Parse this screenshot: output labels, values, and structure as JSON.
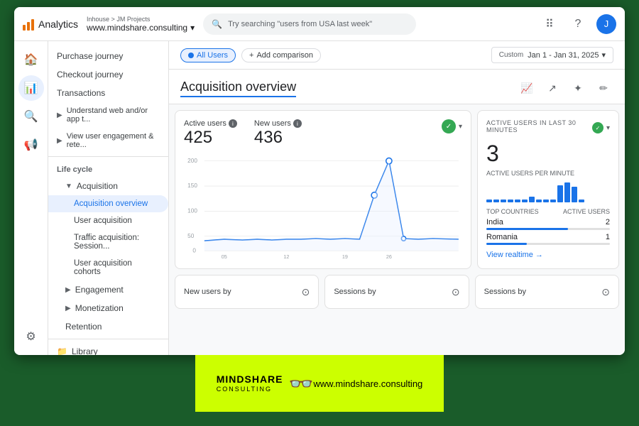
{
  "app": {
    "title": "Analytics",
    "breadcrumb_top": "Inhouse > JM Projects",
    "domain": "www.mindshare.consulting",
    "search_placeholder": "Try searching \"users from USA last week\""
  },
  "header": {
    "date_label": "Custom",
    "date_range": "Jan 1 - Jan 31, 2025"
  },
  "top_chips": {
    "all_users": "All Users",
    "add_comparison": "Add comparison"
  },
  "page": {
    "title": "Acquisition overview"
  },
  "metrics": {
    "active_users_label": "Active users",
    "active_users_value": "425",
    "new_users_label": "New users",
    "new_users_value": "436"
  },
  "realtime": {
    "label": "ACTIVE USERS IN LAST 30 MINUTES",
    "count": "3",
    "per_minute_label": "ACTIVE USERS PER MINUTE",
    "top_countries_label": "TOP COUNTRIES",
    "active_users_col": "ACTIVE USERS",
    "countries": [
      {
        "name": "India",
        "value": "2",
        "pct": 66
      },
      {
        "name": "Romania",
        "value": "1",
        "pct": 33
      }
    ],
    "view_realtime": "View realtime"
  },
  "chart": {
    "y_max": "200",
    "y_mid": "150",
    "y_low": "100",
    "y_zero": "50",
    "x_labels": [
      "05\nJan",
      "12",
      "19",
      "26"
    ],
    "mini_bars": [
      4,
      8,
      6,
      20,
      28,
      24
    ]
  },
  "nav": {
    "sections": [
      {
        "items": [
          {
            "label": "Purchase journey",
            "level": 1
          },
          {
            "label": "Checkout journey",
            "level": 1
          },
          {
            "label": "Transactions",
            "level": 1
          },
          {
            "label": "Understand web and/or app t...",
            "level": 0,
            "expandable": true
          },
          {
            "label": "View user engagement & rete...",
            "level": 0,
            "expandable": true
          }
        ]
      },
      {
        "label": "Life cycle",
        "items": [
          {
            "label": "Acquisition",
            "level": 1,
            "expandable": true,
            "expanded": true
          },
          {
            "label": "Acquisition overview",
            "level": 2,
            "active": true
          },
          {
            "label": "User acquisition",
            "level": 2
          },
          {
            "label": "Traffic acquisition: Session...",
            "level": 2
          },
          {
            "label": "User acquisition cohorts",
            "level": 2
          },
          {
            "label": "Engagement",
            "level": 1,
            "expandable": true
          },
          {
            "label": "Monetization",
            "level": 1,
            "expandable": true
          },
          {
            "label": "Retention",
            "level": 1
          }
        ]
      },
      {
        "items": [
          {
            "label": "Library",
            "level": 0,
            "icon": "folder"
          }
        ]
      }
    ]
  },
  "bottom_cards": [
    {
      "label": "New users by"
    },
    {
      "label": "Sessions by"
    },
    {
      "label": "Sessions by"
    }
  ],
  "footer": {
    "logo_text": "mindshare",
    "logo_sub": "CONSULTING",
    "url": "www.mindshare.consulting"
  }
}
